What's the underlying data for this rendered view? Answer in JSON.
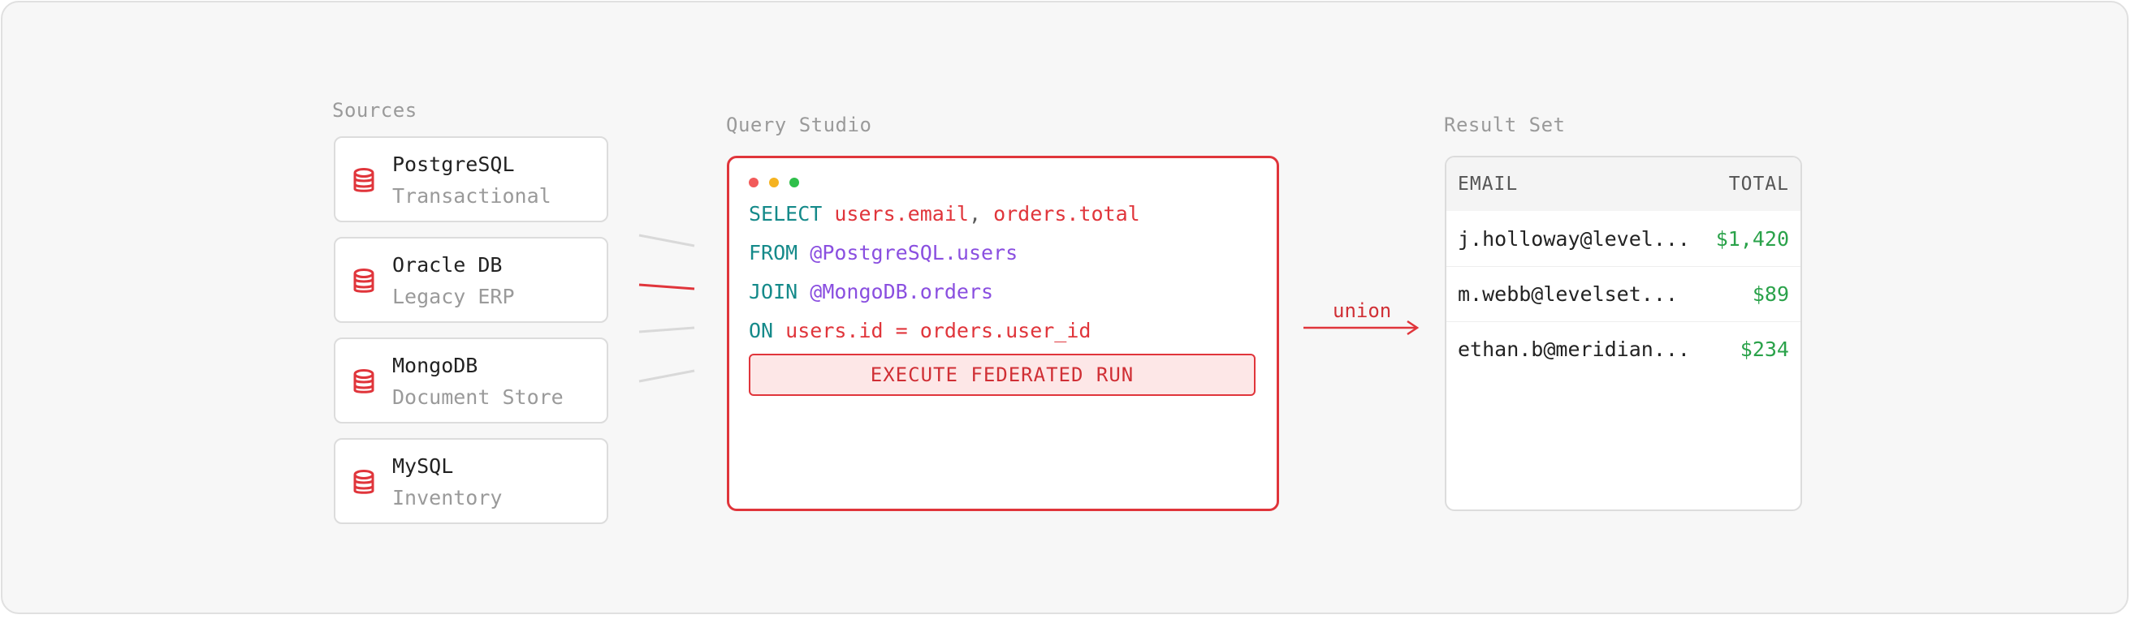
{
  "sections": {
    "sources_label": "Sources",
    "studio_label": "Query Studio",
    "result_label": "Result Set"
  },
  "sources": [
    {
      "name": "PostgreSQL",
      "subtitle": "Transactional"
    },
    {
      "name": "Oracle DB",
      "subtitle": "Legacy ERP"
    },
    {
      "name": "MongoDB",
      "subtitle": "Document Store"
    },
    {
      "name": "MySQL",
      "subtitle": "Inventory"
    }
  ],
  "query": {
    "line1": {
      "keyword": "SELECT",
      "col1": "users.email",
      "sep": ",",
      "col2": "orders.total"
    },
    "line2": {
      "keyword": "FROM",
      "source": "@PostgreSQL.users"
    },
    "line3": {
      "keyword": "JOIN",
      "source": "@MongoDB.orders"
    },
    "line4": {
      "keyword": "ON",
      "condition": "users.id = orders.user_id"
    },
    "execute_label": "EXECUTE FEDERATED RUN"
  },
  "connector": {
    "label": "union"
  },
  "result_table": {
    "headers": {
      "email": "EMAIL",
      "total": "TOTAL"
    },
    "rows": [
      {
        "email": "j.holloway@level...",
        "total": "$1,420"
      },
      {
        "email": "m.webb@levelset...",
        "total": "$89"
      },
      {
        "email": "ethan.b@meridian...",
        "total": "$234"
      }
    ]
  },
  "colors": {
    "accent": "#e0353b",
    "keyword": "#158a8a",
    "source_ref": "#8a4fe0",
    "amount": "#2aa24a",
    "window_dots": [
      "#f25a5a",
      "#f5b320",
      "#2fbf4a"
    ]
  },
  "icons": {
    "source": "database-icon",
    "arrow": "arrow-right-icon"
  }
}
